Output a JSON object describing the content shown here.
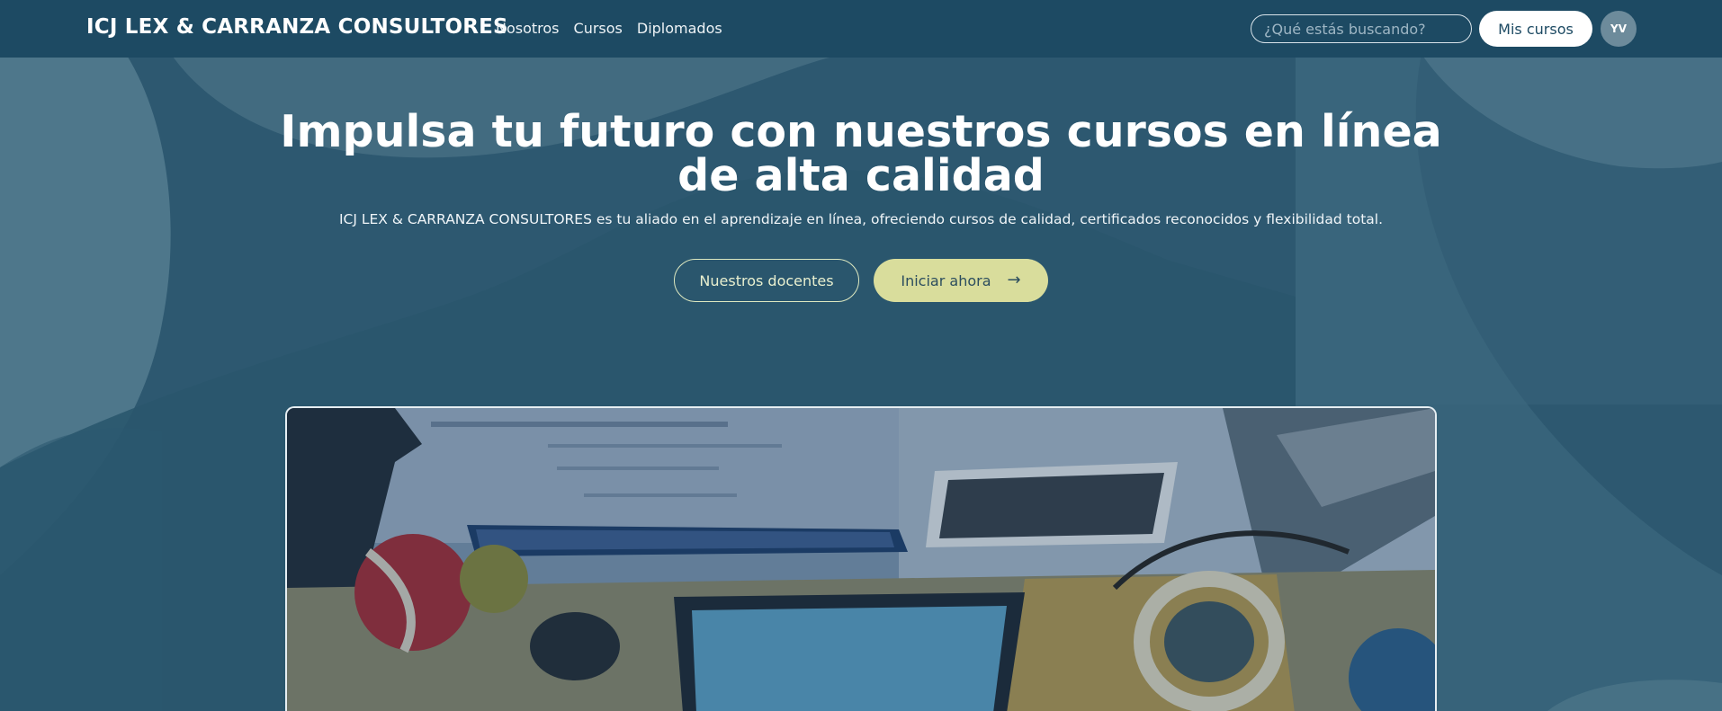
{
  "navbar": {
    "brand": "ICJ LEX & CARRANZA CONSULTORES",
    "links": [
      "Nosotros",
      "Cursos",
      "Diplomados"
    ],
    "search_placeholder": "¿Qué estás buscando?",
    "my_courses_label": "Mis cursos",
    "avatar_initials": "YV"
  },
  "hero": {
    "title": "Impulsa tu futuro con nuestros cursos en línea de alta calidad",
    "subtitle": "ICJ LEX & CARRANZA CONSULTORES es tu aliado en el aprendizaje en línea, ofreciendo cursos de calidad, certificados reconocidos y flexibilidad total.",
    "secondary_button": "Nuestros docentes",
    "primary_button": "Iniciar ahora",
    "primary_button_icon": "arrow-right-icon",
    "image_alt": "desk-workspace-photo"
  },
  "colors": {
    "navbar_bg": "#1d4a63",
    "page_bg": "#2e5a70",
    "accent": "#d9dd9c",
    "text": "#ffffff"
  }
}
